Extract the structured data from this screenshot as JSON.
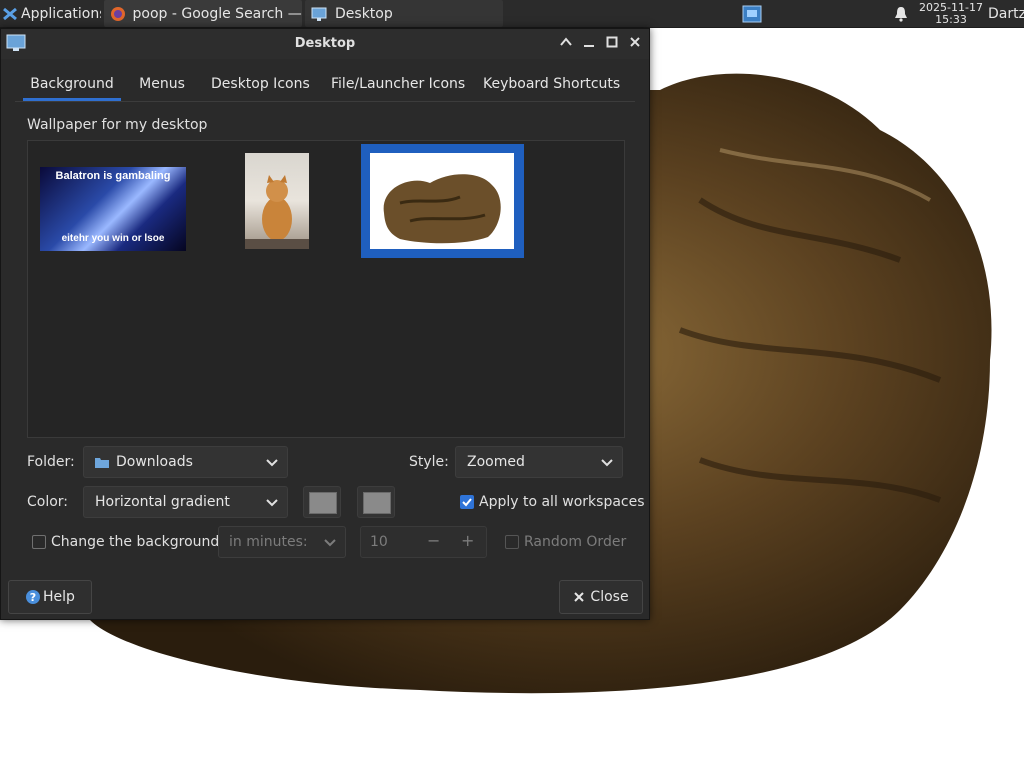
{
  "panel": {
    "apps_label": "Applications",
    "tasks": [
      {
        "label": "poop - Google Search — ..."
      },
      {
        "label": "Desktop"
      }
    ],
    "clock_date": "2025-11-17",
    "clock_time": "15:33",
    "user": "Dartz"
  },
  "dialog": {
    "title": "Desktop",
    "tabs": [
      {
        "label": "Background"
      },
      {
        "label": "Menus"
      },
      {
        "label": "Desktop Icons"
      },
      {
        "label": "File/Launcher Icons"
      },
      {
        "label": "Keyboard Shortcuts"
      }
    ],
    "active_tab": "Background",
    "wallpaper_label": "Wallpaper for my desktop",
    "thumbnails": [
      {
        "line1": "Balatron is gambaling",
        "line2": "eitehr you  win or lsoe"
      },
      {},
      {
        "selected": true
      }
    ],
    "folder_label": "Folder:",
    "folder_value": "Downloads",
    "style_label": "Style:",
    "style_value": "Zoomed",
    "color_label": "Color:",
    "color_value": "Horizontal gradient",
    "apply_all_label": "Apply to all workspaces",
    "apply_all_checked": true,
    "change_bg_label": "Change the background",
    "change_bg_checked": false,
    "interval_value": "in minutes:",
    "interval_number": "10",
    "random_order_label": "Random Order",
    "help_label": "Help",
    "close_label": "Close"
  },
  "colors": {
    "accent": "#2f74d8",
    "panel_bg": "#2b2b2b",
    "dialog_bg": "#2a2a2a",
    "color_swatch": "#8a8a8a"
  },
  "icons": [
    "xfce-logo-icon",
    "firefox-icon",
    "desktop-window-icon",
    "workspace-icon",
    "bell-icon",
    "folder-icon",
    "chevron-down-icon",
    "help-icon",
    "close-icon"
  ]
}
